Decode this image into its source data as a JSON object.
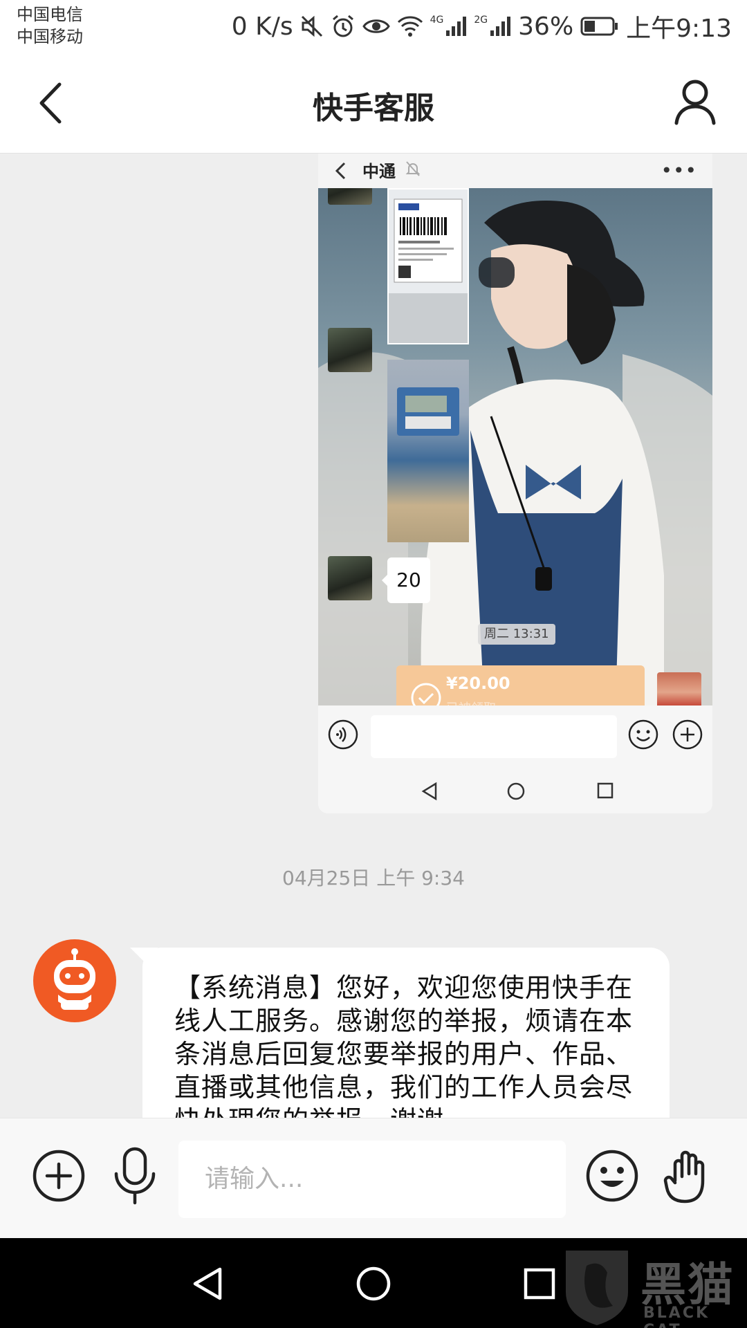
{
  "status_bar": {
    "carrier_1": "中国电信",
    "carrier_2": "中国移动",
    "speed": "0 K/s",
    "battery": "36%",
    "time": "上午9:13",
    "network_1": "4G",
    "network_2": "2G",
    "icons": [
      "mute-icon",
      "alarm-icon",
      "eye-icon",
      "wifi-icon",
      "signal-icon",
      "battery-icon"
    ]
  },
  "header": {
    "title": "快手客服"
  },
  "shared_screenshot": {
    "chat_title": "中通",
    "reply_value": "20",
    "time": "周二 13:31",
    "transfer_amount": "¥20.00",
    "transfer_status": "已被领取"
  },
  "timestamp": "04月25日 上午 9:34",
  "bot_message": {
    "text": "【系统消息】您好，欢迎您使用快手在线人工服务。感谢您的举报，烦请在本条消息后回复您要举报的用户、作品、直播或其他信息，我们的工作人员会尽快处理您的举报，谢谢。"
  },
  "input_bar": {
    "placeholder": "请输入..."
  },
  "watermark": {
    "text": "黑猫",
    "sub": "BLACK CAT"
  },
  "colors": {
    "brand": "#f05a24",
    "transfer": "#f6c898"
  }
}
